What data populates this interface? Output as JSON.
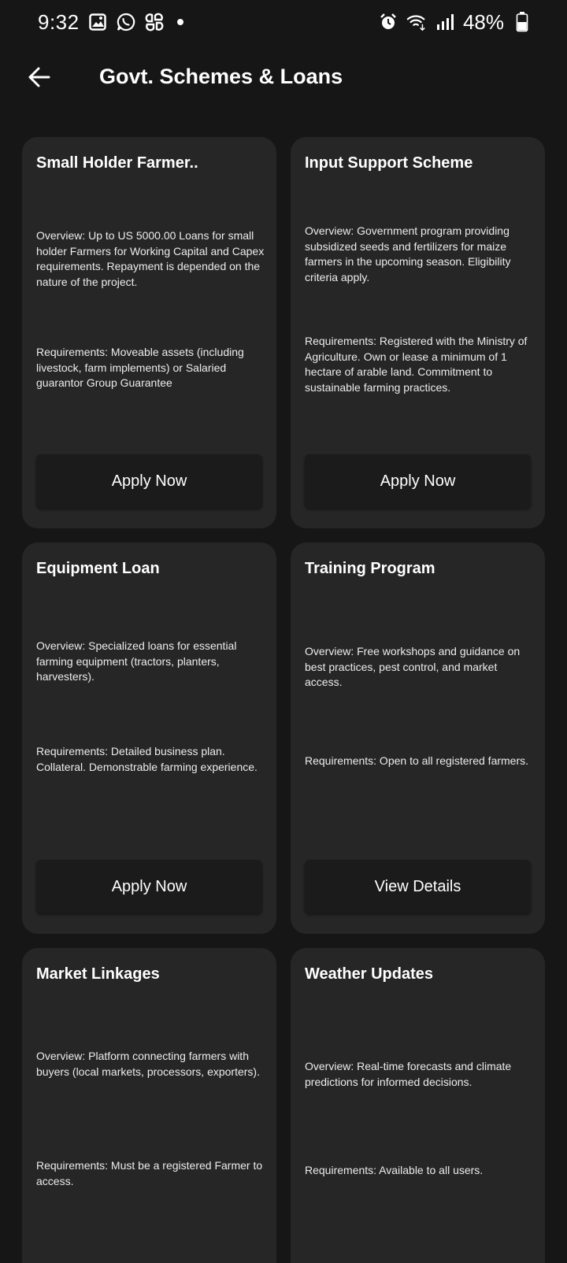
{
  "status_bar": {
    "time": "9:32",
    "battery": "48%",
    "left_icons": [
      "gallery-icon",
      "whatsapp-icon",
      "slack-icon",
      "notification-dot"
    ],
    "right_icons": [
      "alarm-icon",
      "wifi-icon",
      "signal-icon",
      "battery-icon"
    ]
  },
  "header": {
    "title": "Govt. Schemes & Loans"
  },
  "cards": [
    {
      "title": "Small Holder Farmer..",
      "overview": "Overview: Up to US 5000.00 Loans for small holder Farmers for Working Capital and Capex requirements. Repayment is depended on the nature of the project.",
      "requirements": "Requirements: Moveable assets (including livestock, farm implements) or Salaried guarantor Group Guarantee",
      "button": "Apply Now"
    },
    {
      "title": "Input Support Scheme",
      "overview": "Overview: Government program providing subsidized seeds and fertilizers for maize farmers in the upcoming season. Eligibility criteria apply.",
      "requirements": "Requirements: Registered with the Ministry of Agriculture. Own or lease a minimum of 1 hectare of arable land. Commitment to sustainable farming practices.",
      "button": "Apply Now"
    },
    {
      "title": "Equipment Loan",
      "overview": "Overview: Specialized loans for essential farming equipment (tractors, planters, harvesters).",
      "requirements": "Requirements: Detailed business plan. Collateral. Demonstrable farming experience.",
      "button": "Apply Now"
    },
    {
      "title": "Training Program",
      "overview": "Overview: Free workshops and guidance on best practices, pest control, and market access.",
      "requirements": "Requirements: Open to all registered farmers.",
      "button": "View Details"
    },
    {
      "title": "Market Linkages",
      "overview": "Overview: Platform connecting farmers with buyers (local markets, processors, exporters).",
      "requirements": "Requirements: Must be a registered Farmer to access."
    },
    {
      "title": "Weather Updates",
      "overview": "Overview: Real-time forecasts and climate predictions for informed decisions.",
      "requirements": "Requirements: Available to all users."
    }
  ]
}
